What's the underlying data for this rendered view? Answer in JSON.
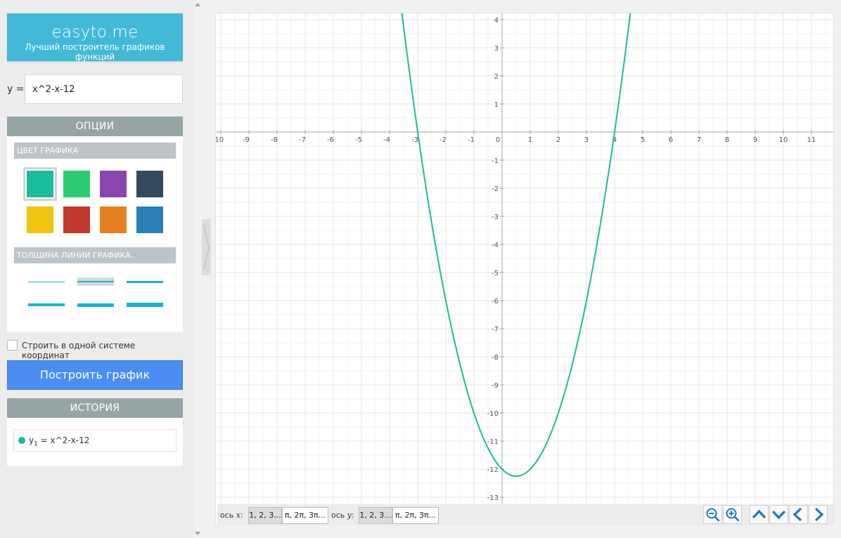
{
  "sidebar": {
    "logo": {
      "brand": "easyto.me",
      "tagline": "Лучший построитель графиков функций"
    },
    "function_input": {
      "label": "y =",
      "value": "x^2-x-12"
    },
    "options": {
      "title": "ОПЦИИ",
      "color_title": "ЦВЕТ ГРАФИКА",
      "colors": [
        "#1abc9c",
        "#2ecc71",
        "#8e44ad",
        "#34495e",
        "#f1c40f",
        "#c0392b",
        "#e67e22",
        "#2980b9"
      ],
      "selected_color_index": 0,
      "thickness_title": "ТОЛЩИНА ЛИНИИ ГРАФИКА",
      "thicknesses": [
        1,
        2,
        3,
        4,
        5,
        6
      ],
      "selected_thickness_index": 1
    },
    "same_system": {
      "label": "Строить в одной системе координат",
      "checked": false
    },
    "plot_button": "Построить график",
    "history": {
      "title": "ИСТОРИЯ",
      "items": [
        {
          "color": "#1abc9c",
          "name": "y",
          "subscript": "1",
          "expr": " = x^2-x-12"
        }
      ]
    }
  },
  "graph": {
    "function": "x^2-x-12",
    "curve_color": "#1abc9c",
    "x_range": [
      -10.5,
      11.7
    ],
    "y_range": [
      -13.2,
      4.2
    ],
    "x_ticks": [
      -10,
      -9,
      -8,
      -7,
      -6,
      -5,
      -4,
      -3,
      -2,
      -1,
      0,
      1,
      2,
      3,
      4,
      5,
      6,
      7,
      8,
      9,
      10,
      11
    ],
    "y_ticks": [
      4,
      3,
      2,
      1,
      -1,
      -2,
      -3,
      -4,
      -5,
      -6,
      -7,
      -8,
      -9,
      -10,
      -11,
      -12,
      -13
    ],
    "grid_step": 0.5
  },
  "bottom_bar": {
    "x_axis_label": "ось x:",
    "x_axis_var": "x",
    "y_axis_label": "ось y:",
    "y_axis_var": "y",
    "x_options": [
      "1, 2, 3...",
      "π, 2π, 3π..."
    ],
    "y_options": [
      "1, 2, 3...",
      "π, 2π, 3π..."
    ],
    "x_selected": 0,
    "y_selected": 0
  },
  "nav": {
    "icons": [
      "zoom-out-icon",
      "zoom-in-icon",
      "chevron-up-icon",
      "chevron-down-icon",
      "chevron-left-icon",
      "chevron-right-icon"
    ],
    "accent": "#1b78c9"
  }
}
